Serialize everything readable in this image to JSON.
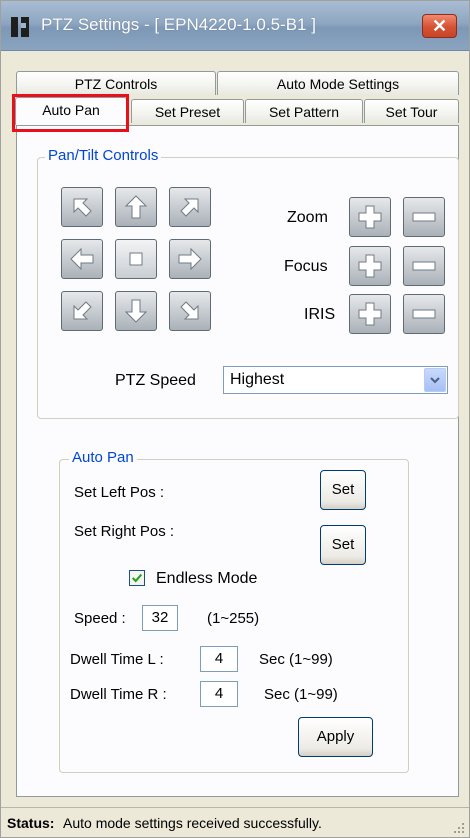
{
  "window": {
    "title": "PTZ Settings - [ EPN4220-1.0.5-B1 ]",
    "close_glyph": "✕"
  },
  "tabs_row1": [
    "PTZ Controls",
    "Auto Mode Settings"
  ],
  "tabs_row2": [
    "Auto Pan",
    "Set Preset",
    "Set Pattern",
    "Set Tour"
  ],
  "active_tab": "Auto Pan",
  "pan_tilt": {
    "legend": "Pan/Tilt Controls",
    "zoom_label": "Zoom",
    "focus_label": "Focus",
    "iris_label": "IRIS",
    "speed_label": "PTZ Speed",
    "speed_value": "Highest"
  },
  "auto_pan": {
    "legend": "Auto Pan",
    "set_left_label": "Set Left Pos :",
    "set_right_label": "Set Right Pos :",
    "set_button": "Set",
    "endless_label": "Endless Mode",
    "endless_checked": true,
    "speed_label": "Speed :",
    "speed_value": "32",
    "speed_range": "(1~255)",
    "dwell_l_label": "Dwell Time L :",
    "dwell_l_value": "4",
    "dwell_l_range": "Sec (1~99)",
    "dwell_r_label": "Dwell Time R :",
    "dwell_r_value": "4",
    "dwell_r_range": "Sec (1~99)",
    "apply_button": "Apply"
  },
  "status": {
    "label": "Status:",
    "text": "Auto mode settings received successfully."
  },
  "colors": {
    "legend": "#0046d5",
    "tab_highlight": "#e8101a"
  },
  "icons": [
    "arrow-up-left-icon",
    "arrow-up-icon",
    "arrow-up-right-icon",
    "arrow-left-icon",
    "stop-icon",
    "arrow-right-icon",
    "arrow-down-left-icon",
    "arrow-down-icon",
    "arrow-down-right-icon",
    "plus-icon",
    "minus-icon",
    "chevron-down-icon"
  ]
}
